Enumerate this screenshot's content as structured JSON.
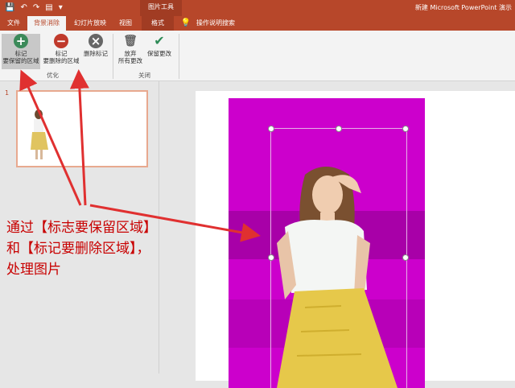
{
  "quick_access": {
    "save_icon": "save-icon",
    "undo_icon": "undo-icon",
    "redo_icon": "redo-icon",
    "start_icon": "slideshow-start-icon",
    "more_icon": "customize-icon"
  },
  "context_tool_label": "图片工具",
  "doc_title": "新建 Microsoft PowerPoint 演示",
  "tabs": [
    "文件",
    "背景消除",
    "幻灯片放映",
    "视图",
    "格式"
  ],
  "tell_me": "操作说明搜索",
  "ribbon": {
    "mark_keep": "标记\n要保留的区域",
    "mark_remove": "标记\n要删除的区域",
    "delete_mark": "删除标记",
    "group_refine": "优化",
    "discard": "放弃\n所有更改",
    "keep_changes": "保留更改",
    "group_close": "关闭"
  },
  "slide_number": "1",
  "annotation": {
    "line1": "通过【标志要保留区域】",
    "line2": "和【标记要删除区域】，",
    "line3": "处理图片"
  },
  "colors": {
    "accent": "#b7472a",
    "removal_overlay": "#cc00cc",
    "annotation": "#c80000"
  }
}
